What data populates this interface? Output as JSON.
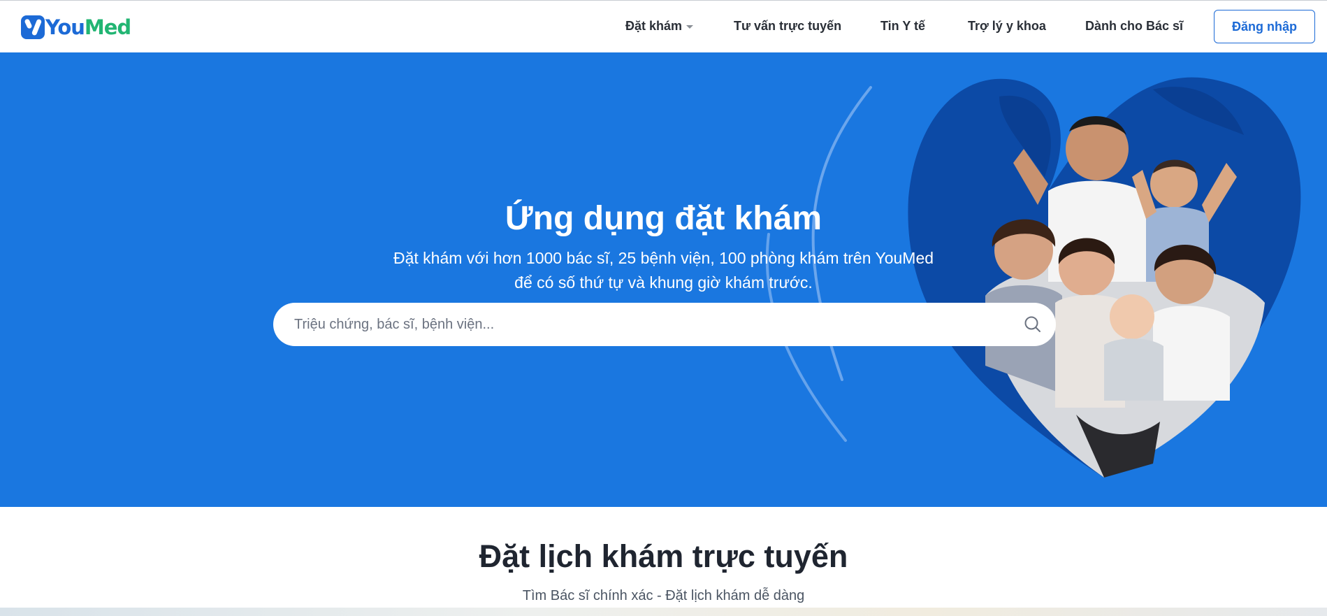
{
  "brand": {
    "name_part1": "You",
    "name_part2": "Med",
    "colors": {
      "primary": "#1c6ad6",
      "accent": "#22b573",
      "hero_bg": "#1a77e0"
    }
  },
  "nav": {
    "items": [
      {
        "label": "Đặt khám",
        "has_dropdown": true
      },
      {
        "label": "Tư vấn trực tuyến"
      },
      {
        "label": "Tin Y tế"
      },
      {
        "label": "Trợ lý y khoa"
      },
      {
        "label": "Dành cho Bác sĩ"
      }
    ],
    "login_label": "Đăng nhập"
  },
  "hero": {
    "title": "Ứng dụng đặt khám",
    "subtitle_line1": "Đặt khám với hơn 1000 bác sĩ, 25 bệnh viện, 100 phòng khám trên YouMed",
    "subtitle_line2": "để có số thứ tự và khung giờ khám trước.",
    "search": {
      "placeholder": "Triệu chứng, bác sĩ, bệnh viện...",
      "value": "",
      "icon": "search-icon"
    }
  },
  "section": {
    "title": "Đặt lịch khám trực tuyến",
    "subtitle": "Tìm Bác sĩ chính xác - Đặt lịch khám dễ dàng"
  }
}
